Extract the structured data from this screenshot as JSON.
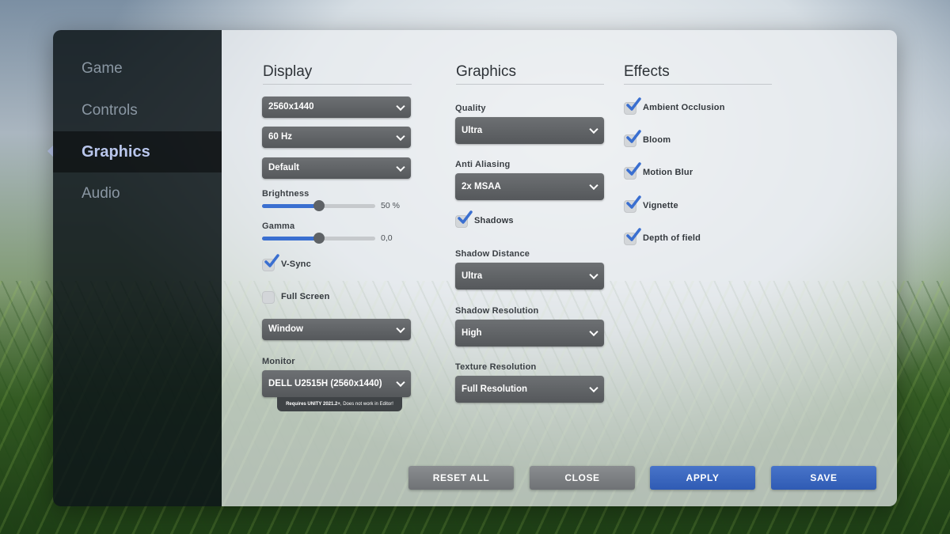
{
  "sidebar": {
    "items": [
      {
        "label": "Game"
      },
      {
        "label": "Controls"
      },
      {
        "label": "Graphics",
        "active": true
      },
      {
        "label": "Audio"
      }
    ]
  },
  "display": {
    "title": "Display",
    "resolution": "2560x1440",
    "refresh_rate": "60 Hz",
    "preset": "Default",
    "brightness": {
      "label": "Brightness",
      "value_text": "50 %",
      "value": 0.5
    },
    "gamma": {
      "label": "Gamma",
      "value_text": "0,0",
      "value": 0.5
    },
    "vsync": {
      "label": "V-Sync",
      "checked": true
    },
    "fullscreen": {
      "label": "Full Screen",
      "checked": false
    },
    "window_mode": "Window",
    "monitor": {
      "label": "Monitor",
      "value": "DELL U2515H (2560x1440)",
      "note_bold": "Requires UNITY 2021.2+",
      "note": ", Does not work in Editor!"
    }
  },
  "graphics": {
    "title": "Graphics",
    "quality": {
      "label": "Quality",
      "value": "Ultra"
    },
    "anti_aliasing": {
      "label": "Anti Aliasing",
      "value": "2x MSAA"
    },
    "shadows": {
      "label": "Shadows",
      "checked": true
    },
    "shadow_distance": {
      "label": "Shadow Distance",
      "value": "Ultra"
    },
    "shadow_resolution": {
      "label": "Shadow Resolution",
      "value": "High"
    },
    "texture_resolution": {
      "label": "Texture Resolution",
      "value": "Full Resolution"
    }
  },
  "effects": {
    "title": "Effects",
    "items": [
      {
        "label": "Ambient Occlusion",
        "checked": true
      },
      {
        "label": "Bloom",
        "checked": true
      },
      {
        "label": "Motion Blur",
        "checked": true
      },
      {
        "label": "Vignette",
        "checked": true
      },
      {
        "label": "Depth of field",
        "checked": true
      }
    ]
  },
  "buttons": {
    "reset_all": "RESET ALL",
    "close": "CLOSE",
    "apply": "APPLY",
    "save": "SAVE"
  },
  "colors": {
    "accent": "#3a6fd0",
    "button_blue": "#3a64bd",
    "button_gray": "#7d8083",
    "sidebar_active": "#b9c6ec"
  }
}
